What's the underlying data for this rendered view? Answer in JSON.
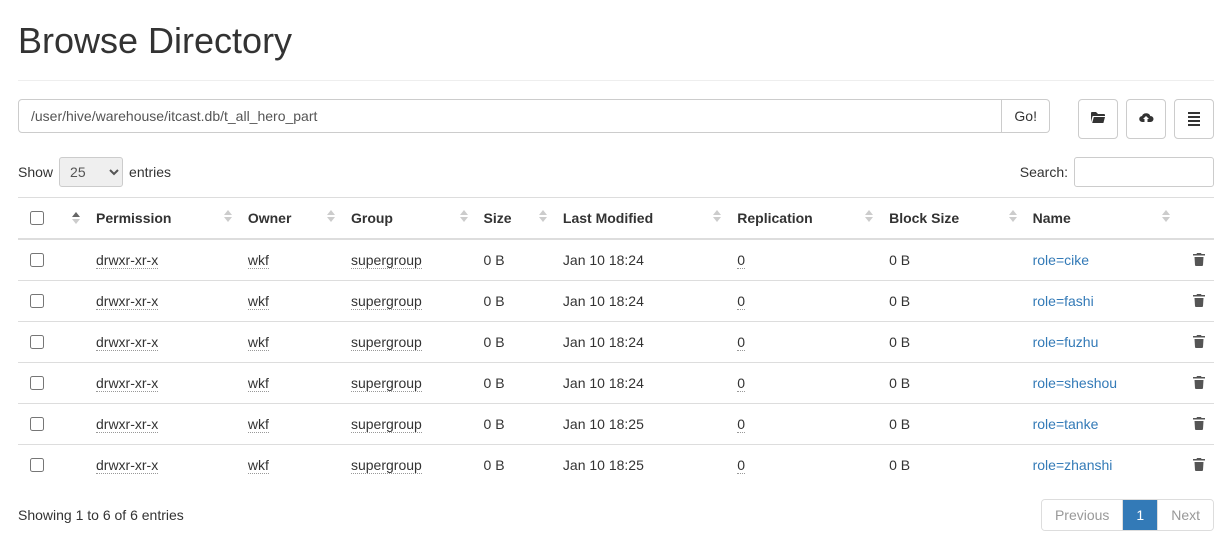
{
  "title": "Browse Directory",
  "path": "/user/hive/warehouse/itcast.db/t_all_hero_part",
  "go_label": "Go!",
  "show_label_pre": "Show",
  "show_label_post": "entries",
  "show_value": "25",
  "search_label": "Search:",
  "columns": {
    "permission": "Permission",
    "owner": "Owner",
    "group": "Group",
    "size": "Size",
    "last_modified": "Last Modified",
    "replication": "Replication",
    "block_size": "Block Size",
    "name": "Name"
  },
  "rows": [
    {
      "permission": "drwxr-xr-x",
      "owner": "wkf",
      "group": "supergroup",
      "size": "0 B",
      "last_modified": "Jan 10 18:24",
      "replication": "0",
      "block_size": "0 B",
      "name": "role=cike"
    },
    {
      "permission": "drwxr-xr-x",
      "owner": "wkf",
      "group": "supergroup",
      "size": "0 B",
      "last_modified": "Jan 10 18:24",
      "replication": "0",
      "block_size": "0 B",
      "name": "role=fashi"
    },
    {
      "permission": "drwxr-xr-x",
      "owner": "wkf",
      "group": "supergroup",
      "size": "0 B",
      "last_modified": "Jan 10 18:24",
      "replication": "0",
      "block_size": "0 B",
      "name": "role=fuzhu"
    },
    {
      "permission": "drwxr-xr-x",
      "owner": "wkf",
      "group": "supergroup",
      "size": "0 B",
      "last_modified": "Jan 10 18:24",
      "replication": "0",
      "block_size": "0 B",
      "name": "role=sheshou"
    },
    {
      "permission": "drwxr-xr-x",
      "owner": "wkf",
      "group": "supergroup",
      "size": "0 B",
      "last_modified": "Jan 10 18:25",
      "replication": "0",
      "block_size": "0 B",
      "name": "role=tanke"
    },
    {
      "permission": "drwxr-xr-x",
      "owner": "wkf",
      "group": "supergroup",
      "size": "0 B",
      "last_modified": "Jan 10 18:25",
      "replication": "0",
      "block_size": "0 B",
      "name": "role=zhanshi"
    }
  ],
  "info": "Showing 1 to 6 of 6 entries",
  "pagination": {
    "previous": "Previous",
    "next": "Next",
    "current": "1"
  }
}
